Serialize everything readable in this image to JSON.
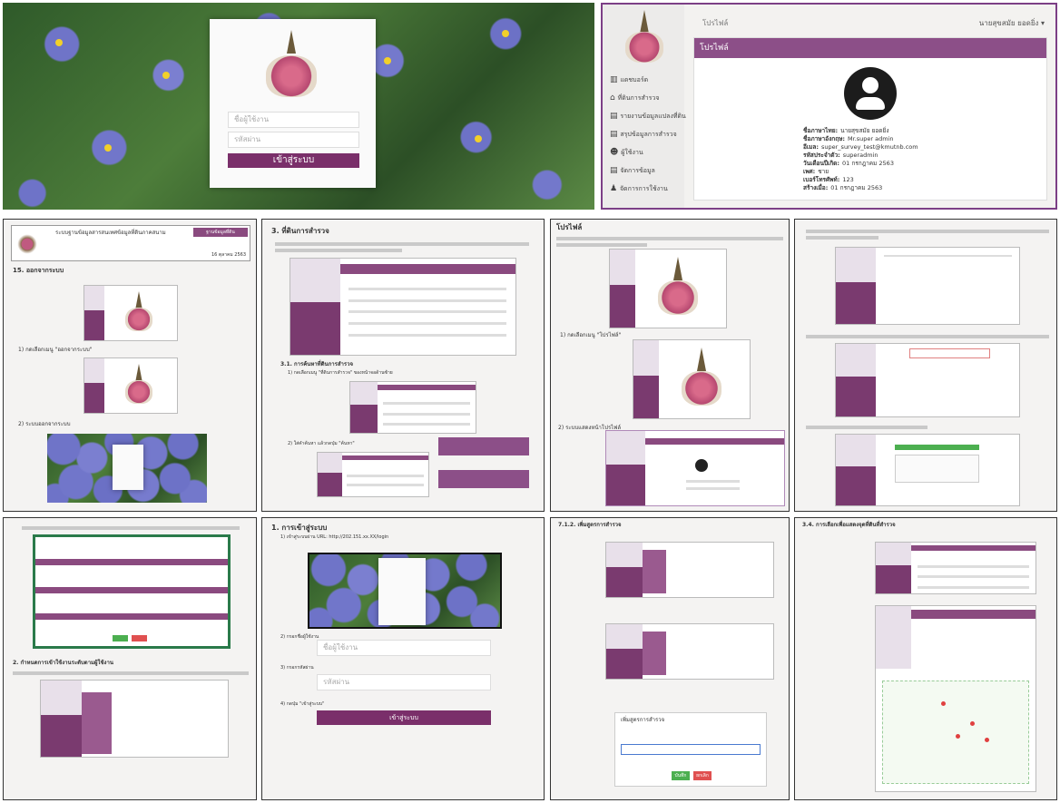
{
  "login_screen": {
    "username_placeholder": "ชื่อผู้ใช้งาน",
    "password_placeholder": "รหัสผ่าน",
    "login_button": "เข้าสู่ระบบ"
  },
  "profile_screen": {
    "breadcrumb": "โปรไฟล์",
    "user_menu": "นายสุขสมัย ยอดยิ่ง",
    "panel_title": "โปรไฟล์",
    "sidebar": [
      {
        "icon": "chart-icon",
        "label": "แดชบอร์ด"
      },
      {
        "icon": "home-icon",
        "label": "ที่ดินการสำรวจ"
      },
      {
        "icon": "file-icon",
        "label": "รายงานข้อมูลแปลงที่ดิน"
      },
      {
        "icon": "file-icon",
        "label": "สรุปข้อมูลการสำรวจ"
      },
      {
        "icon": "users-icon",
        "label": "ผู้ใช้งาน"
      },
      {
        "icon": "file-icon",
        "label": "จัดการข้อมูล"
      },
      {
        "icon": "user-icon",
        "label": "จัดการการใช้งาน"
      }
    ],
    "fields": [
      {
        "label": "ชื่อภาษาไทย:",
        "value": "นายสุขสมัย ยอดยิ่ง"
      },
      {
        "label": "ชื่อภาษาอังกฤษ:",
        "value": "Mr.super admin"
      },
      {
        "label": "อีเมล:",
        "value": "super_survey_test@kmutnb.com"
      },
      {
        "label": "รหัสประจำตัว:",
        "value": "superadmin"
      },
      {
        "label": "วันเดือนปีเกิด:",
        "value": "01 กรกฎาคม 2563"
      },
      {
        "label": "เพศ:",
        "value": "ชาย"
      },
      {
        "label": "เบอร์โทรศัพท์:",
        "value": "123"
      },
      {
        "label": "สร้างเมื่อ:",
        "value": "01 กรกฎาคม 2563"
      }
    ]
  },
  "doc_pages": {
    "p1_heading": "15. ออกจากระบบ",
    "p1_header_table": [
      "ระบบฐานข้อมูลสารสนเทศข้อมูลที่ดินภาคสนาม",
      "ฐานข้อมูลที่ดิน",
      "16 ตุลาคม 2563"
    ],
    "p1_steps": [
      "1) กดเลือกเมนู \"ออกจากระบบ\"",
      "2) ระบบออกจากระบบ"
    ],
    "p2_heading": "3. ที่ดินการสำรวจ",
    "p2_sub": "3.1. การค้นหาที่ดินการสำรวจ",
    "p2_steps": [
      "1) กดเลือกเมนู \"ที่ดินการสำรวจ\" ของหน้าจอด้านซ้าย",
      "2) ใส่คำค้นหา แล้วกดปุ่ม \"ค้นหา\""
    ],
    "p3_heading": "โปรไฟล์",
    "p3_steps": [
      "1) กดเลือกเมนู \"โปรไฟล์\"",
      "2) ระบบแสดงหน้าโปรไฟล์"
    ],
    "p6_heading": "1. การเข้าสู่ระบบ",
    "p6_steps": [
      "1) เข้าสู่ระบบผ่าน URL: http://202.151.xx.XX/login",
      "2) กรอกชื่อผู้ใช้งาน",
      "3) กรอกรหัสผ่าน",
      "4) กดปุ่ม \"เข้าสู่ระบบ\""
    ],
    "p6_username": "ชื่อผู้ใช้งาน",
    "p6_password": "รหัสผ่าน",
    "p6_button": "เข้าสู่ระบบ",
    "p7_heading": "7.1.2. เพิ่มสูตรการสำรวจ",
    "p7_dialog_title": "เพิ่มสูตรการสำรวจ",
    "p7_ok": "บันทึก",
    "p7_cancel": "ยกเลิก",
    "p8_heading": "3.4. การเลือกเพื่อแสดงจุดที่ดินที่สำรวจ",
    "p5_heading": "2. กำหนดการเข้าใช้งานระดับตามผู้ใช้งาน",
    "p5_buttons": [
      "บันทึก",
      "ยกเลิก"
    ]
  }
}
